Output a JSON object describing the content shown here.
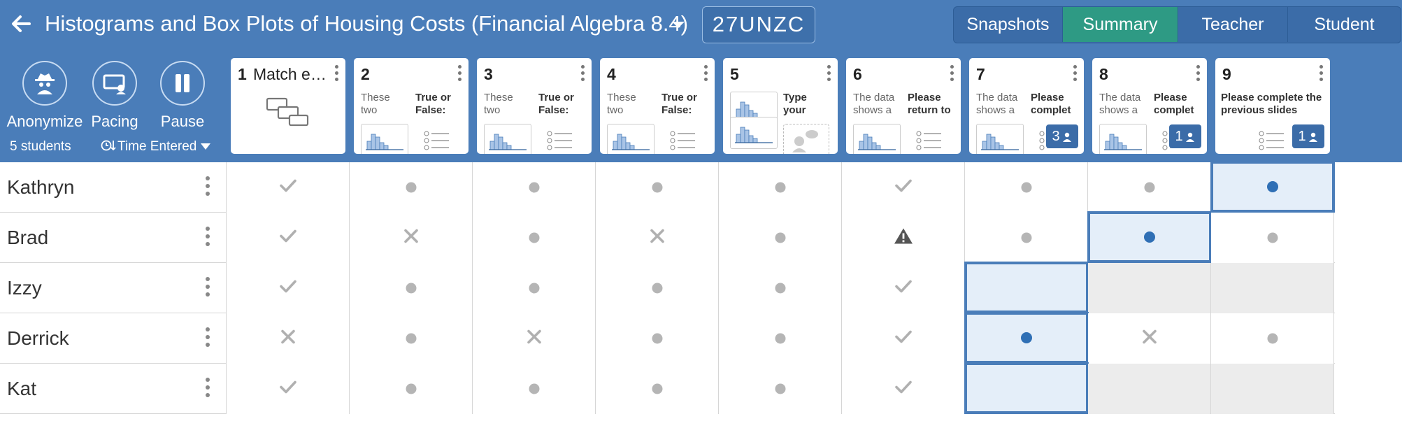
{
  "header": {
    "title": "Histograms and Box Plots of Housing Costs (Financial Algebra 8.4)",
    "class_code": "27UNZC",
    "view_tabs": [
      {
        "label": "Snapshots",
        "active": false
      },
      {
        "label": "Summary",
        "active": true
      },
      {
        "label": "Teacher",
        "active": false
      },
      {
        "label": "Student",
        "active": false
      }
    ]
  },
  "toolbar": {
    "anonymize_label": "Anonymize",
    "pacing_label": "Pacing",
    "pause_label": "Pause",
    "students_count": "5 students",
    "sort_label": "Time Entered"
  },
  "slides": [
    {
      "num": "1",
      "title": "Match e…",
      "type": "match"
    },
    {
      "num": "2",
      "left": "These two",
      "right": "True or False:",
      "type": "chart-list"
    },
    {
      "num": "3",
      "left": "These two",
      "right": "True or False:",
      "type": "chart-list"
    },
    {
      "num": "4",
      "left": "These two",
      "right": "True or False:",
      "type": "chart-list"
    },
    {
      "num": "5",
      "right": "Type your",
      "type": "charts-text"
    },
    {
      "num": "6",
      "left": "The data shows a",
      "right": "Please return to",
      "type": "chart-list"
    },
    {
      "num": "7",
      "left": "The data shows a",
      "right": "Please complet",
      "type": "chart-list",
      "badge": "3"
    },
    {
      "num": "8",
      "left": "The data shows a",
      "right": "Please complet",
      "type": "chart-list",
      "badge": "1"
    },
    {
      "num": "9",
      "wide": "Please complete the previous slides",
      "type": "wide",
      "badge": "1"
    }
  ],
  "students": [
    {
      "name": "Kathryn",
      "cells": [
        "check",
        "dot",
        "dot",
        "dot",
        "dot",
        "check",
        "dot",
        "dot",
        "current-dot"
      ]
    },
    {
      "name": "Brad",
      "cells": [
        "check",
        "x",
        "dot",
        "x",
        "dot",
        "warn",
        "dot",
        "current-dot",
        "dot"
      ]
    },
    {
      "name": "Izzy",
      "cells": [
        "check",
        "dot",
        "dot",
        "dot",
        "dot",
        "check",
        "current",
        "locked",
        "locked"
      ]
    },
    {
      "name": "Derrick",
      "cells": [
        "x",
        "dot",
        "x",
        "dot",
        "dot",
        "check",
        "current-dot",
        "x",
        "dot"
      ]
    },
    {
      "name": "Kat",
      "cells": [
        "check",
        "dot",
        "dot",
        "dot",
        "dot",
        "check",
        "current",
        "locked",
        "locked"
      ]
    }
  ],
  "colors": {
    "header_bg": "#4a7db9",
    "active_tab": "#2e9a84",
    "current_border": "#4a7db9",
    "current_fill": "#e4eef9",
    "locked_fill": "#ececec"
  }
}
